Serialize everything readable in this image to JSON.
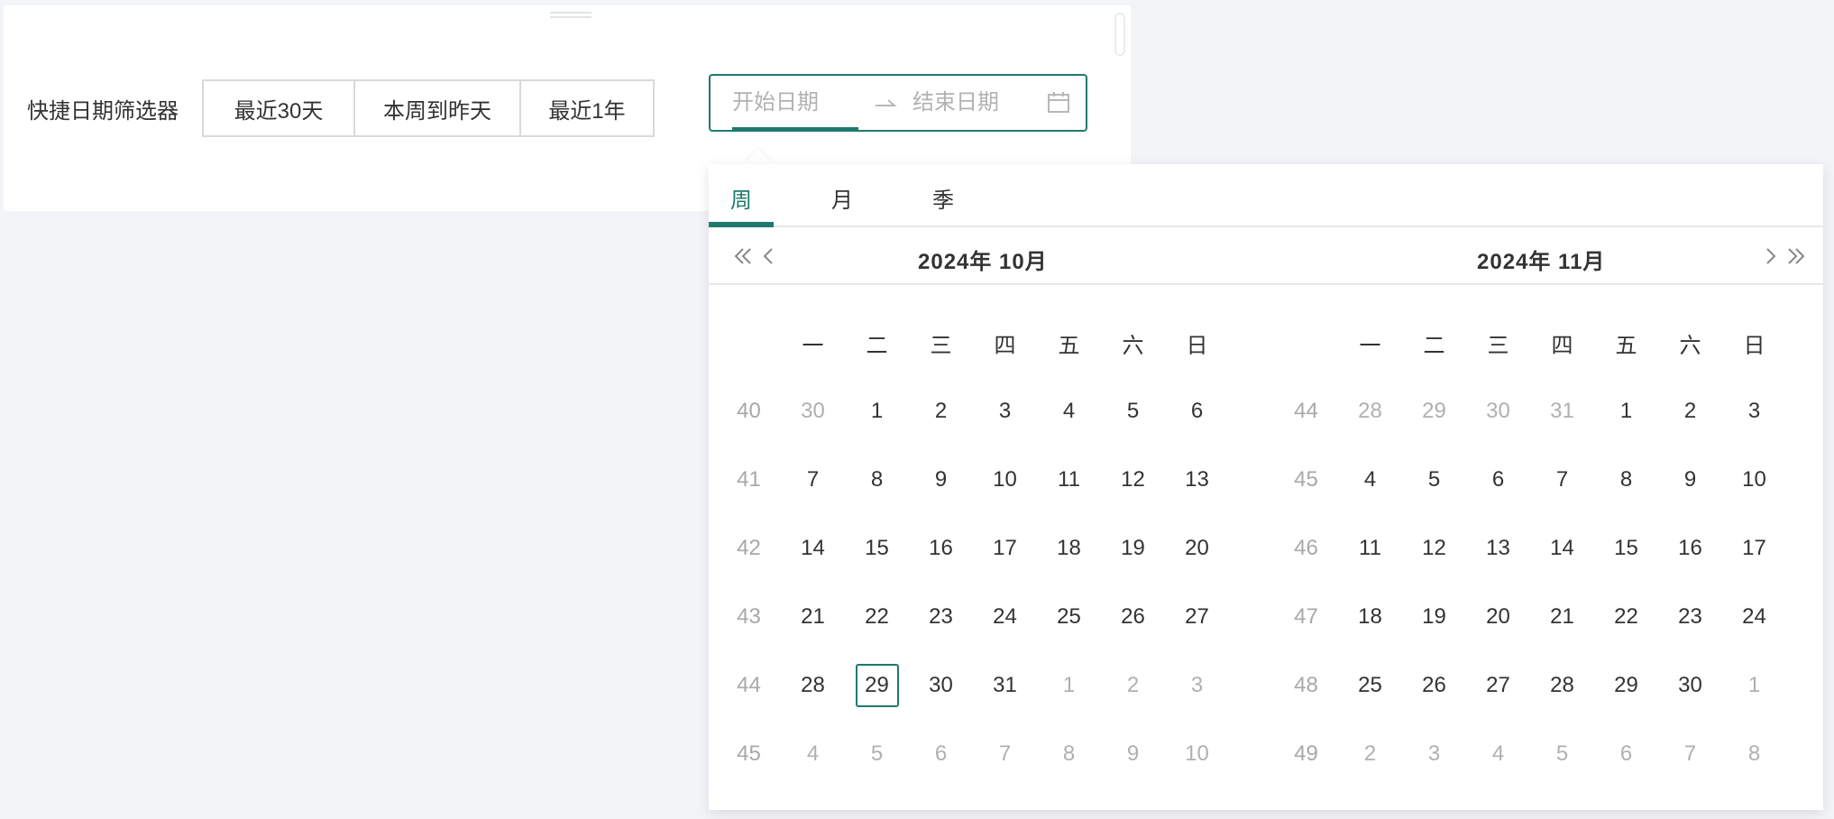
{
  "filter": {
    "label": "快捷日期筛选器",
    "quick_buttons": [
      "最近30天",
      "本周到昨天",
      "最近1年"
    ]
  },
  "range_picker": {
    "start_placeholder": "开始日期",
    "end_placeholder": "结束日期",
    "separator_icon": "arrow-right-icon",
    "calendar_icon": "calendar-icon"
  },
  "popup": {
    "tabs": [
      "周",
      "月",
      "季"
    ],
    "active_tab": "周",
    "left_title": "2024年  10月",
    "right_title": "2024年  11月",
    "weekdays": [
      "一",
      "二",
      "三",
      "四",
      "五",
      "六",
      "日"
    ],
    "left_weeks": [
      {
        "wk": "40",
        "days": [
          {
            "d": "30",
            "o": 1
          },
          {
            "d": "1"
          },
          {
            "d": "2"
          },
          {
            "d": "3"
          },
          {
            "d": "4"
          },
          {
            "d": "5"
          },
          {
            "d": "6"
          }
        ]
      },
      {
        "wk": "41",
        "days": [
          {
            "d": "7"
          },
          {
            "d": "8"
          },
          {
            "d": "9"
          },
          {
            "d": "10"
          },
          {
            "d": "11"
          },
          {
            "d": "12"
          },
          {
            "d": "13"
          }
        ]
      },
      {
        "wk": "42",
        "days": [
          {
            "d": "14"
          },
          {
            "d": "15"
          },
          {
            "d": "16"
          },
          {
            "d": "17"
          },
          {
            "d": "18"
          },
          {
            "d": "19"
          },
          {
            "d": "20"
          }
        ]
      },
      {
        "wk": "43",
        "days": [
          {
            "d": "21"
          },
          {
            "d": "22"
          },
          {
            "d": "23"
          },
          {
            "d": "24"
          },
          {
            "d": "25"
          },
          {
            "d": "26"
          },
          {
            "d": "27"
          }
        ]
      },
      {
        "wk": "44",
        "days": [
          {
            "d": "28"
          },
          {
            "d": "29",
            "t": 1
          },
          {
            "d": "30"
          },
          {
            "d": "31"
          },
          {
            "d": "1",
            "o": 1
          },
          {
            "d": "2",
            "o": 1
          },
          {
            "d": "3",
            "o": 1
          }
        ]
      },
      {
        "wk": "45",
        "days": [
          {
            "d": "4",
            "o": 1
          },
          {
            "d": "5",
            "o": 1
          },
          {
            "d": "6",
            "o": 1
          },
          {
            "d": "7",
            "o": 1
          },
          {
            "d": "8",
            "o": 1
          },
          {
            "d": "9",
            "o": 1
          },
          {
            "d": "10",
            "o": 1
          }
        ]
      }
    ],
    "right_weeks": [
      {
        "wk": "44",
        "days": [
          {
            "d": "28",
            "o": 1
          },
          {
            "d": "29",
            "o": 1
          },
          {
            "d": "30",
            "o": 1
          },
          {
            "d": "31",
            "o": 1
          },
          {
            "d": "1"
          },
          {
            "d": "2"
          },
          {
            "d": "3"
          }
        ]
      },
      {
        "wk": "45",
        "days": [
          {
            "d": "4"
          },
          {
            "d": "5"
          },
          {
            "d": "6"
          },
          {
            "d": "7"
          },
          {
            "d": "8"
          },
          {
            "d": "9"
          },
          {
            "d": "10"
          }
        ]
      },
      {
        "wk": "46",
        "days": [
          {
            "d": "11"
          },
          {
            "d": "12"
          },
          {
            "d": "13"
          },
          {
            "d": "14"
          },
          {
            "d": "15"
          },
          {
            "d": "16"
          },
          {
            "d": "17"
          }
        ]
      },
      {
        "wk": "47",
        "days": [
          {
            "d": "18"
          },
          {
            "d": "19"
          },
          {
            "d": "20"
          },
          {
            "d": "21"
          },
          {
            "d": "22"
          },
          {
            "d": "23"
          },
          {
            "d": "24"
          }
        ]
      },
      {
        "wk": "48",
        "days": [
          {
            "d": "25"
          },
          {
            "d": "26"
          },
          {
            "d": "27"
          },
          {
            "d": "28"
          },
          {
            "d": "29"
          },
          {
            "d": "30"
          },
          {
            "d": "1",
            "o": 1
          }
        ]
      },
      {
        "wk": "49",
        "days": [
          {
            "d": "2",
            "o": 1
          },
          {
            "d": "3",
            "o": 1
          },
          {
            "d": "4",
            "o": 1
          },
          {
            "d": "5",
            "o": 1
          },
          {
            "d": "6",
            "o": 1
          },
          {
            "d": "7",
            "o": 1
          },
          {
            "d": "8",
            "o": 1
          }
        ]
      }
    ]
  },
  "colors": {
    "accent": "#1f7a6d",
    "page_bg": "#f3f4f8",
    "muted_text": "#b0b0b0"
  }
}
